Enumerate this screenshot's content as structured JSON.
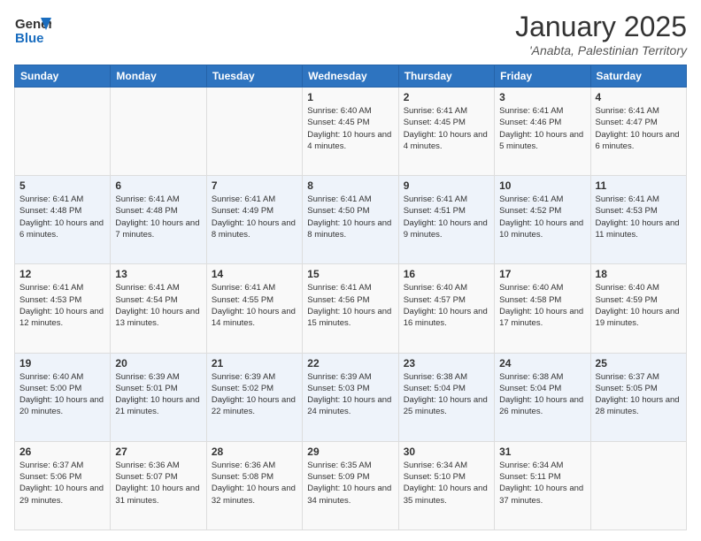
{
  "logo": {
    "general": "General",
    "blue": "Blue"
  },
  "header": {
    "title": "January 2025",
    "subtitle": "'Anabta, Palestinian Territory"
  },
  "weekdays": [
    "Sunday",
    "Monday",
    "Tuesday",
    "Wednesday",
    "Thursday",
    "Friday",
    "Saturday"
  ],
  "weeks": [
    [
      {
        "day": "",
        "info": ""
      },
      {
        "day": "",
        "info": ""
      },
      {
        "day": "",
        "info": ""
      },
      {
        "day": "1",
        "info": "Sunrise: 6:40 AM\nSunset: 4:45 PM\nDaylight: 10 hours\nand 4 minutes."
      },
      {
        "day": "2",
        "info": "Sunrise: 6:41 AM\nSunset: 4:45 PM\nDaylight: 10 hours\nand 4 minutes."
      },
      {
        "day": "3",
        "info": "Sunrise: 6:41 AM\nSunset: 4:46 PM\nDaylight: 10 hours\nand 5 minutes."
      },
      {
        "day": "4",
        "info": "Sunrise: 6:41 AM\nSunset: 4:47 PM\nDaylight: 10 hours\nand 6 minutes."
      }
    ],
    [
      {
        "day": "5",
        "info": "Sunrise: 6:41 AM\nSunset: 4:48 PM\nDaylight: 10 hours\nand 6 minutes."
      },
      {
        "day": "6",
        "info": "Sunrise: 6:41 AM\nSunset: 4:48 PM\nDaylight: 10 hours\nand 7 minutes."
      },
      {
        "day": "7",
        "info": "Sunrise: 6:41 AM\nSunset: 4:49 PM\nDaylight: 10 hours\nand 8 minutes."
      },
      {
        "day": "8",
        "info": "Sunrise: 6:41 AM\nSunset: 4:50 PM\nDaylight: 10 hours\nand 8 minutes."
      },
      {
        "day": "9",
        "info": "Sunrise: 6:41 AM\nSunset: 4:51 PM\nDaylight: 10 hours\nand 9 minutes."
      },
      {
        "day": "10",
        "info": "Sunrise: 6:41 AM\nSunset: 4:52 PM\nDaylight: 10 hours\nand 10 minutes."
      },
      {
        "day": "11",
        "info": "Sunrise: 6:41 AM\nSunset: 4:53 PM\nDaylight: 10 hours\nand 11 minutes."
      }
    ],
    [
      {
        "day": "12",
        "info": "Sunrise: 6:41 AM\nSunset: 4:53 PM\nDaylight: 10 hours\nand 12 minutes."
      },
      {
        "day": "13",
        "info": "Sunrise: 6:41 AM\nSunset: 4:54 PM\nDaylight: 10 hours\nand 13 minutes."
      },
      {
        "day": "14",
        "info": "Sunrise: 6:41 AM\nSunset: 4:55 PM\nDaylight: 10 hours\nand 14 minutes."
      },
      {
        "day": "15",
        "info": "Sunrise: 6:41 AM\nSunset: 4:56 PM\nDaylight: 10 hours\nand 15 minutes."
      },
      {
        "day": "16",
        "info": "Sunrise: 6:40 AM\nSunset: 4:57 PM\nDaylight: 10 hours\nand 16 minutes."
      },
      {
        "day": "17",
        "info": "Sunrise: 6:40 AM\nSunset: 4:58 PM\nDaylight: 10 hours\nand 17 minutes."
      },
      {
        "day": "18",
        "info": "Sunrise: 6:40 AM\nSunset: 4:59 PM\nDaylight: 10 hours\nand 19 minutes."
      }
    ],
    [
      {
        "day": "19",
        "info": "Sunrise: 6:40 AM\nSunset: 5:00 PM\nDaylight: 10 hours\nand 20 minutes."
      },
      {
        "day": "20",
        "info": "Sunrise: 6:39 AM\nSunset: 5:01 PM\nDaylight: 10 hours\nand 21 minutes."
      },
      {
        "day": "21",
        "info": "Sunrise: 6:39 AM\nSunset: 5:02 PM\nDaylight: 10 hours\nand 22 minutes."
      },
      {
        "day": "22",
        "info": "Sunrise: 6:39 AM\nSunset: 5:03 PM\nDaylight: 10 hours\nand 24 minutes."
      },
      {
        "day": "23",
        "info": "Sunrise: 6:38 AM\nSunset: 5:04 PM\nDaylight: 10 hours\nand 25 minutes."
      },
      {
        "day": "24",
        "info": "Sunrise: 6:38 AM\nSunset: 5:04 PM\nDaylight: 10 hours\nand 26 minutes."
      },
      {
        "day": "25",
        "info": "Sunrise: 6:37 AM\nSunset: 5:05 PM\nDaylight: 10 hours\nand 28 minutes."
      }
    ],
    [
      {
        "day": "26",
        "info": "Sunrise: 6:37 AM\nSunset: 5:06 PM\nDaylight: 10 hours\nand 29 minutes."
      },
      {
        "day": "27",
        "info": "Sunrise: 6:36 AM\nSunset: 5:07 PM\nDaylight: 10 hours\nand 31 minutes."
      },
      {
        "day": "28",
        "info": "Sunrise: 6:36 AM\nSunset: 5:08 PM\nDaylight: 10 hours\nand 32 minutes."
      },
      {
        "day": "29",
        "info": "Sunrise: 6:35 AM\nSunset: 5:09 PM\nDaylight: 10 hours\nand 34 minutes."
      },
      {
        "day": "30",
        "info": "Sunrise: 6:34 AM\nSunset: 5:10 PM\nDaylight: 10 hours\nand 35 minutes."
      },
      {
        "day": "31",
        "info": "Sunrise: 6:34 AM\nSunset: 5:11 PM\nDaylight: 10 hours\nand 37 minutes."
      },
      {
        "day": "",
        "info": ""
      }
    ]
  ]
}
